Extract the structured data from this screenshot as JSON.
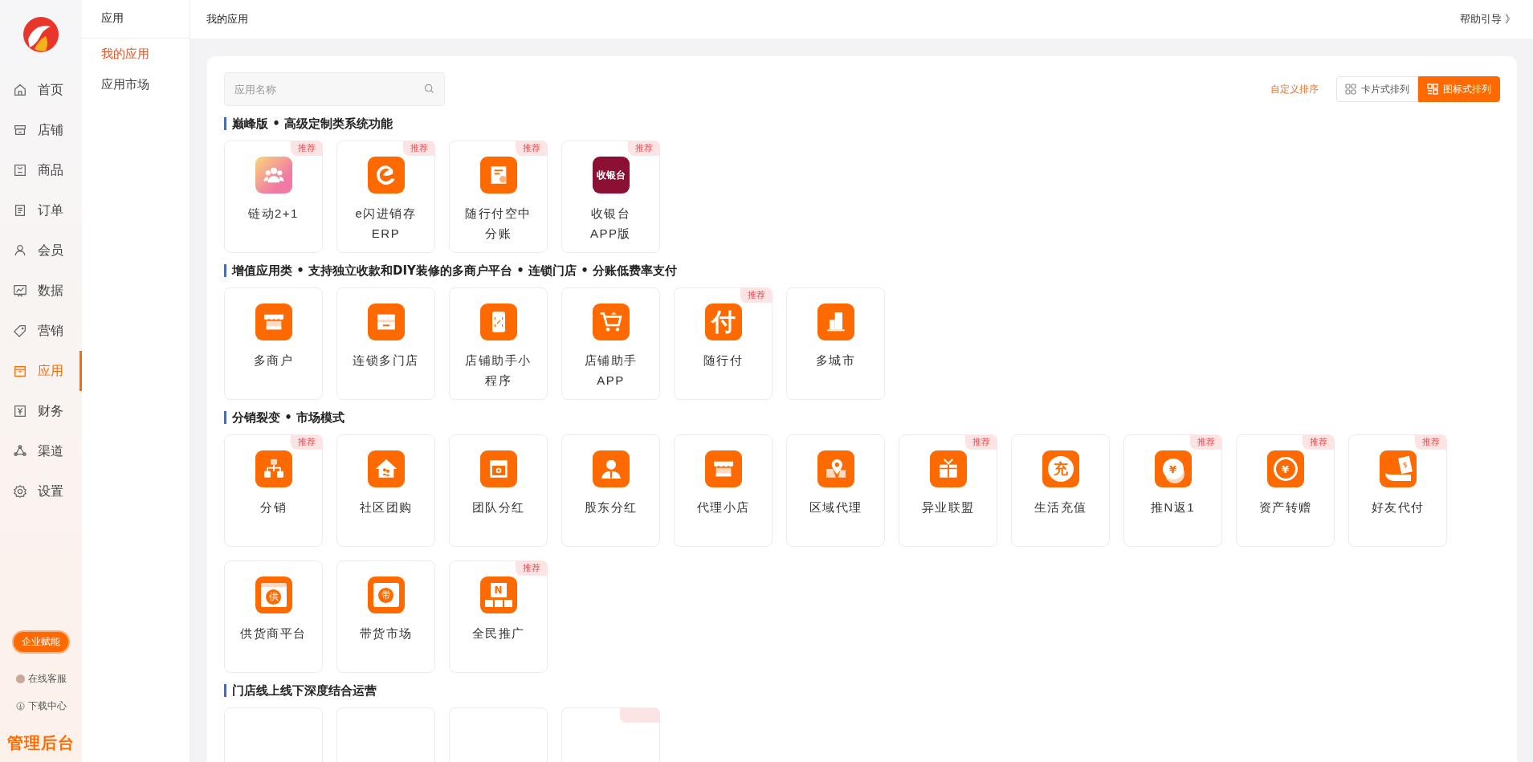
{
  "sidebar": {
    "nav": [
      {
        "label": "首页",
        "kind": "home",
        "selected": false
      },
      {
        "label": "店铺",
        "kind": "shop",
        "selected": false
      },
      {
        "label": "商品",
        "kind": "goods",
        "selected": false
      },
      {
        "label": "订单",
        "kind": "order",
        "selected": false
      },
      {
        "label": "会员",
        "kind": "user",
        "selected": false
      },
      {
        "label": "数据",
        "kind": "chart",
        "selected": false
      },
      {
        "label": "营销",
        "kind": "tag",
        "selected": false
      },
      {
        "label": "应用",
        "kind": "app",
        "selected": true
      },
      {
        "label": "财务",
        "kind": "finance",
        "selected": false
      },
      {
        "label": "渠道",
        "kind": "channel",
        "selected": false
      },
      {
        "label": "设置",
        "kind": "settings",
        "selected": false
      }
    ],
    "promo_button": "企业赋能",
    "links": [
      {
        "label": "在线客服",
        "kind": "avatar"
      },
      {
        "label": "下载中心",
        "kind": "download"
      }
    ],
    "brand": "管理后台"
  },
  "submenu": {
    "title": "应用",
    "items": [
      {
        "label": "我的应用",
        "selected": true
      },
      {
        "label": "应用市场",
        "selected": false
      }
    ]
  },
  "header": {
    "breadcrumb": "我的应用",
    "help_link": "帮助引导 》"
  },
  "toolbar": {
    "search": {
      "placeholder": "应用名称"
    },
    "sort_link": "自定义排序",
    "view_modes": [
      {
        "label": "卡片式排列",
        "kind": "cards",
        "selected": false
      },
      {
        "label": "图标式排列",
        "kind": "icons",
        "selected": true
      }
    ]
  },
  "sections": [
    {
      "title": "巅峰版 • 高级定制类系统功能",
      "apps": [
        {
          "name": "链动2+1",
          "kind": "people",
          "badge": "推荐"
        },
        {
          "name": "e闪进销存ERP",
          "kind": "swirl",
          "badge": "推荐"
        },
        {
          "name": "随行付空中分账",
          "kind": "receipt",
          "badge": "推荐"
        },
        {
          "name": "收银台APP版",
          "kind": "cashier",
          "glyph": "收银台",
          "badge": "推荐"
        }
      ]
    },
    {
      "title": "增值应用类 • 支持独立收款和DIY装修的多商户平台 • 连锁门店 • 分账低费率支付",
      "apps": [
        {
          "name": "多商户",
          "kind": "store"
        },
        {
          "name": "连锁多门店",
          "kind": "drawer"
        },
        {
          "name": "店铺助手小程序",
          "kind": "phone"
        },
        {
          "name": "店铺助手APP",
          "kind": "cart"
        },
        {
          "name": "随行付",
          "kind": "glyph",
          "glyph": "付",
          "badge": "推荐"
        },
        {
          "name": "多城市",
          "kind": "building"
        }
      ]
    },
    {
      "title": "分销裂变 • 市场模式",
      "apps": [
        {
          "name": "分销",
          "kind": "hierarchy",
          "badge": "推荐"
        },
        {
          "name": "社区团购",
          "kind": "house"
        },
        {
          "name": "团队分红",
          "kind": "coinbox"
        },
        {
          "name": "股东分红",
          "kind": "person"
        },
        {
          "name": "代理小店",
          "kind": "store"
        },
        {
          "name": "区域代理",
          "kind": "mappin"
        },
        {
          "name": "异业联盟",
          "kind": "gift",
          "badge": "推荐"
        },
        {
          "name": "生活充值",
          "kind": "glyph-circle",
          "glyph": "充"
        },
        {
          "name": "推N返1",
          "kind": "coin-hand",
          "glyph": "¥",
          "badge": "推荐"
        },
        {
          "name": "资产转赠",
          "kind": "coin-cycle",
          "glyph": "¥",
          "badge": "推荐"
        },
        {
          "name": "好友代付",
          "kind": "cash-hand",
          "glyph": "$",
          "badge": "推荐"
        },
        {
          "name": "供货商平台",
          "kind": "glyph-box",
          "glyph": "供"
        },
        {
          "name": "带货市场",
          "kind": "glyph-bag",
          "glyph": "带"
        },
        {
          "name": "全民推广",
          "kind": "glyph-tree",
          "glyph": "N",
          "badge": "推荐"
        }
      ]
    },
    {
      "title": "门店线上线下深度结合运营",
      "apps": [
        {
          "corner": false
        },
        {
          "corner": false
        },
        {
          "corner": false
        },
        {
          "corner": true
        }
      ]
    }
  ]
}
